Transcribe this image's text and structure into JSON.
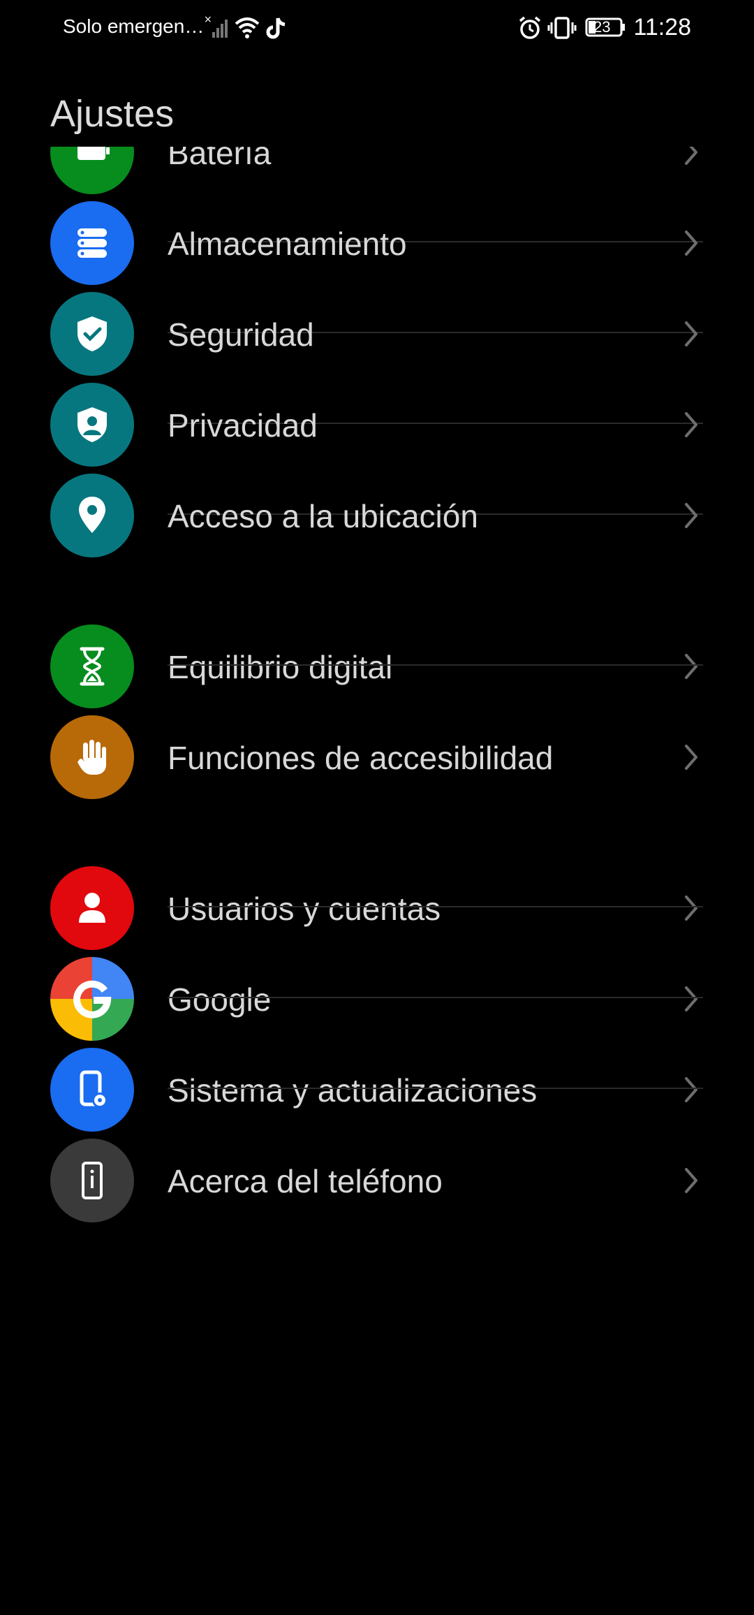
{
  "status_bar": {
    "carrier": "Solo emergen…",
    "battery": "23",
    "time": "11:28",
    "icons": [
      "signal-off-icon",
      "wifi-icon",
      "tiktok-icon",
      "alarm-icon",
      "vibrate-icon",
      "battery-icon"
    ]
  },
  "header": {
    "title": "Ajustes"
  },
  "settings": [
    {
      "label": "Batería",
      "icon": "battery-icon",
      "color": "#078c1e"
    },
    {
      "label": "Almacenamiento",
      "icon": "storage-icon",
      "color": "#1a6cf0"
    },
    {
      "label": "Seguridad",
      "icon": "shield-check-icon",
      "color": "#07777f"
    },
    {
      "label": "Privacidad",
      "icon": "privacy-shield-icon",
      "color": "#07777f"
    },
    {
      "label": "Acceso a la ubicación",
      "icon": "location-pin-icon",
      "color": "#07777f"
    },
    {
      "label": "Equilibrio digital",
      "icon": "hourglass-icon",
      "color": "#078c1e"
    },
    {
      "label": "Funciones de accesibilidad",
      "icon": "hand-icon",
      "color": "#b86a08"
    },
    {
      "label": "Usuarios y cuentas",
      "icon": "user-icon",
      "color": "#e1080e"
    },
    {
      "label": "Google",
      "icon": "google-icon",
      "color": "#ffffff"
    },
    {
      "label": "Sistema y actualizaciones",
      "icon": "phone-gear-icon",
      "color": "#1a6cf0"
    },
    {
      "label": "Acerca del teléfono",
      "icon": "phone-info-icon",
      "color": "#3a3a3a"
    }
  ]
}
